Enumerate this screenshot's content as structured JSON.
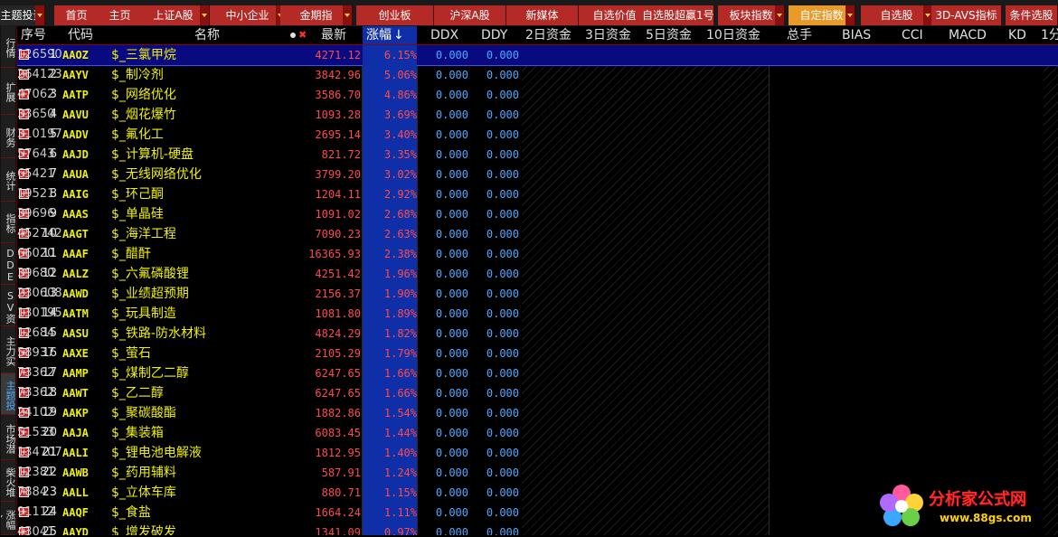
{
  "top_tabs": [
    {
      "label": "主题投资",
      "type": "first",
      "dropdown": true
    },
    {
      "label": "首页",
      "type": "normal",
      "dropdown": false
    },
    {
      "label": "主页",
      "type": "normal",
      "dropdown": false
    },
    {
      "label": "上证A股",
      "type": "normal",
      "dropdown": true
    },
    {
      "label": "中小企业",
      "type": "normal",
      "dropdown": true
    },
    {
      "label": "金期指",
      "type": "normal",
      "dropdown": true
    },
    {
      "label": "创业板",
      "type": "normal",
      "dropdown": false
    },
    {
      "label": "沪深A股",
      "type": "normal",
      "dropdown": false
    },
    {
      "label": "新媒体",
      "type": "normal",
      "dropdown": false
    },
    {
      "label": "自选价值",
      "type": "normal",
      "dropdown": false
    },
    {
      "label": "自选股超赢1号",
      "type": "normal",
      "dropdown": false
    },
    {
      "label": "板块指数",
      "type": "normal",
      "dropdown": true
    },
    {
      "label": "自定指数",
      "type": "active",
      "dropdown": true
    },
    {
      "label": "自选股",
      "type": "normal",
      "dropdown": true
    },
    {
      "label": "3D-AVS指标",
      "type": "normal",
      "dropdown": false
    },
    {
      "label": "条件选股",
      "type": "normal",
      "dropdown": false
    }
  ],
  "side_tabs": [
    {
      "label": "行情",
      "active": false
    },
    {
      "label": "扩展",
      "active": false
    },
    {
      "label": "财务",
      "active": false
    },
    {
      "label": "统计",
      "active": false
    },
    {
      "label": "指标",
      "active": false
    },
    {
      "label": "DDE",
      "active": false
    },
    {
      "label": "SV资",
      "active": false
    },
    {
      "label": "主力实",
      "active": false
    },
    {
      "label": "主题投",
      "active": true
    },
    {
      "label": "市场潜",
      "active": false
    },
    {
      "label": "柴火堆",
      "active": false
    },
    {
      "label": "涨幅Y",
      "active": false
    }
  ],
  "columns": {
    "seq": "序号",
    "code": "代码",
    "name": "名称",
    "latest": "最新",
    "change": "涨幅",
    "change_sort_arrow": "↓",
    "ddx": "DDX",
    "ddy": "DDY",
    "fund2": "2日资金",
    "fund3": "3日资金",
    "fund5": "5日资金",
    "fund10": "10日资金",
    "volume": "总手",
    "bias": "BIAS",
    "cci": "CCI",
    "macd": "MACD",
    "kd": "KD",
    "min1": "1分"
  },
  "rows": [
    {
      "seq": "1",
      "code": "AAOZ",
      "name": "$_三氯甲烷",
      "latest": "4271.12",
      "change": "6.15%",
      "ddx": "0.000",
      "ddy": "0.000",
      "volume": "126590"
    },
    {
      "seq": "2",
      "code": "AAYV",
      "name": "$_制冷剂",
      "latest": "3842.96",
      "change": "5.06%",
      "ddx": "0.000",
      "ddy": "0.000",
      "volume": "264123"
    },
    {
      "seq": "3",
      "code": "AATP",
      "name": "$_网络优化",
      "latest": "3586.70",
      "change": "4.86%",
      "ddx": "0.000",
      "ddy": "0.000",
      "volume": "47062"
    },
    {
      "seq": "4",
      "code": "AAVU",
      "name": "$_烟花爆竹",
      "latest": "1093.28",
      "change": "3.69%",
      "ddx": "0.000",
      "ddy": "0.000",
      "volume": "33650"
    },
    {
      "seq": "5",
      "code": "AADV",
      "name": "$_氟化工",
      "latest": "2695.14",
      "change": "3.40%",
      "ddx": "0.000",
      "ddy": "0.000",
      "volume": "310197"
    },
    {
      "seq": "6",
      "code": "AAJD",
      "name": "$_计算机-硬盘",
      "latest": "821.72",
      "change": "3.35%",
      "ddx": "0.000",
      "ddy": "0.000",
      "volume": "57643"
    },
    {
      "seq": "7",
      "code": "AAUA",
      "name": "$_无线网络优化",
      "latest": "3799.20",
      "change": "3.02%",
      "ddx": "0.000",
      "ddy": "0.000",
      "volume": "65421"
    },
    {
      "seq": "8",
      "code": "AAIG",
      "name": "$_环己酮",
      "latest": "1204.11",
      "change": "2.92%",
      "ddx": "0.000",
      "ddy": "0.000",
      "volume": "19521"
    },
    {
      "seq": "9",
      "code": "AAAS",
      "name": "$_单晶硅",
      "latest": "1091.02",
      "change": "2.68%",
      "ddx": "0.000",
      "ddy": "0.000",
      "volume": "39696"
    },
    {
      "seq": "10",
      "code": "AAGT",
      "name": "$_海洋工程",
      "latest": "7090.23",
      "change": "2.63%",
      "ddx": "0.000",
      "ddy": "0.000",
      "volume": "452742"
    },
    {
      "seq": "11",
      "code": "AAAF",
      "name": "$_醋酐",
      "latest": "16365.93",
      "change": "2.38%",
      "ddx": "0.000",
      "ddy": "0.000",
      "volume": "66020"
    },
    {
      "seq": "12",
      "code": "AALZ",
      "name": "$_六氟磷酸锂",
      "latest": "4251.42",
      "change": "1.96%",
      "ddx": "0.000",
      "ddy": "0.000",
      "volume": "39680"
    },
    {
      "seq": "13",
      "code": "AAWD",
      "name": "$_业绩超预期",
      "latest": "2156.37",
      "change": "1.90%",
      "ddx": "0.000",
      "ddy": "0.000",
      "volume": "230608"
    },
    {
      "seq": "14",
      "code": "AATM",
      "name": "$_玩具制造",
      "latest": "1081.80",
      "change": "1.89%",
      "ddx": "0.000",
      "ddy": "0.000",
      "volume": "130195"
    },
    {
      "seq": "15",
      "code": "AASU",
      "name": "$_铁路-防水材料",
      "latest": "4824.29",
      "change": "1.82%",
      "ddx": "0.000",
      "ddy": "0.000",
      "volume": "12684"
    },
    {
      "seq": "16",
      "code": "AAXE",
      "name": "$_萤石",
      "latest": "2105.29",
      "change": "1.79%",
      "ddx": "0.000",
      "ddy": "0.000",
      "volume": "58937"
    },
    {
      "seq": "17",
      "code": "AAMP",
      "name": "$_煤制乙二醇",
      "latest": "6247.65",
      "change": "1.66%",
      "ddx": "0.000",
      "ddy": "0.000",
      "volume": "73362"
    },
    {
      "seq": "18",
      "code": "AAWT",
      "name": "$_乙二醇",
      "latest": "6247.65",
      "change": "1.66%",
      "ddx": "0.000",
      "ddy": "0.000",
      "volume": "73362"
    },
    {
      "seq": "19",
      "code": "AAKP",
      "name": "$_聚碳酸酯",
      "latest": "1882.86",
      "change": "1.54%",
      "ddx": "0.000",
      "ddy": "0.000",
      "volume": "24102"
    },
    {
      "seq": "20",
      "code": "AAJA",
      "name": "$_集装箱",
      "latest": "6083.45",
      "change": "1.44%",
      "ddx": "0.000",
      "ddy": "0.000",
      "volume": "51533"
    },
    {
      "seq": "21",
      "code": "AALI",
      "name": "$_锂电池电解液",
      "latest": "1812.95",
      "change": "1.40%",
      "ddx": "0.000",
      "ddy": "0.000",
      "volume": "134707"
    },
    {
      "seq": "22",
      "code": "AAWB",
      "name": "$_药用辅料",
      "latest": "587.91",
      "change": "1.24%",
      "ddx": "0.000",
      "ddy": "0.000",
      "volume": "12381"
    },
    {
      "seq": "23",
      "code": "AALL",
      "name": "$_立体车库",
      "latest": "880.71",
      "change": "1.15%",
      "ddx": "0.000",
      "ddy": "0.000",
      "volume": "7884"
    },
    {
      "seq": "24",
      "code": "AAQF",
      "name": "$_食盐",
      "latest": "1664.24",
      "change": "1.11%",
      "ddx": "0.000",
      "ddy": "0.000",
      "volume": "91112"
    },
    {
      "seq": "25",
      "code": "AAYD",
      "name": "$_增发破发",
      "latest": "1341.09",
      "change": "0.97%",
      "ddx": "0.000",
      "ddy": "0.000",
      "volume": "43041"
    }
  ],
  "selected_row": 0,
  "watermark": {
    "title": "分析家公式网",
    "url": "www.88gs.com"
  },
  "colors": {
    "tab_bg": "#b32a26",
    "tab_active": "#e89a2a",
    "price_up": "#ff4a4a",
    "code": "#f0f000",
    "ddx": "#4fa8ff",
    "sort_col": "#0f2fa8"
  }
}
